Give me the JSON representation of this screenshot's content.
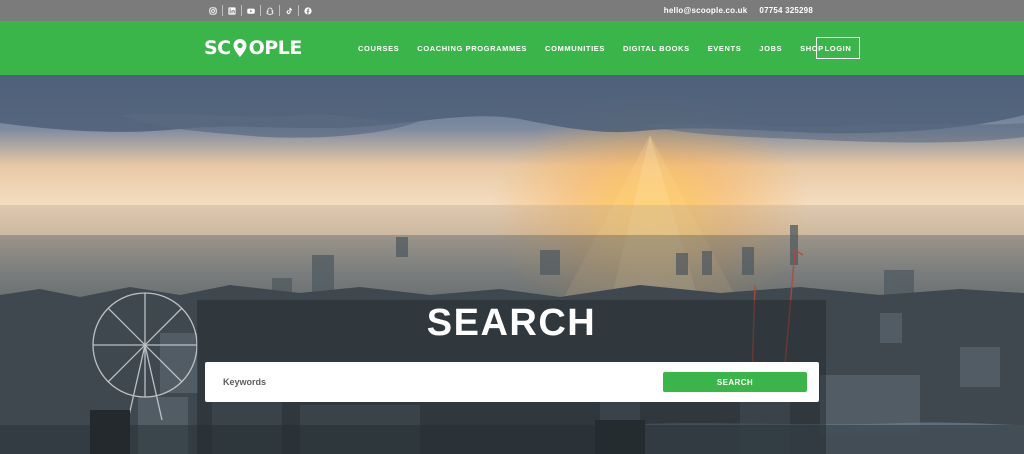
{
  "topbar": {
    "social_icons": [
      "instagram-icon",
      "linkedin-icon",
      "youtube-icon",
      "snapchat-icon",
      "tiktok-icon",
      "facebook-icon"
    ],
    "email": "hello@scoople.co.uk",
    "phone": "07754 325298"
  },
  "brand": {
    "logo_left": "SC",
    "logo_right": "OPLE",
    "color": "#3ab54a"
  },
  "nav": {
    "items": [
      "COURSES",
      "COACHING PROGRAMMES",
      "COMMUNITIES",
      "DIGITAL BOOKS",
      "EVENTS",
      "JOBS",
      "SHOP"
    ],
    "login": "LOGIN"
  },
  "hero": {
    "title": "SEARCH",
    "search_placeholder": "Keywords",
    "search_value": "",
    "search_button": "SEARCH"
  }
}
